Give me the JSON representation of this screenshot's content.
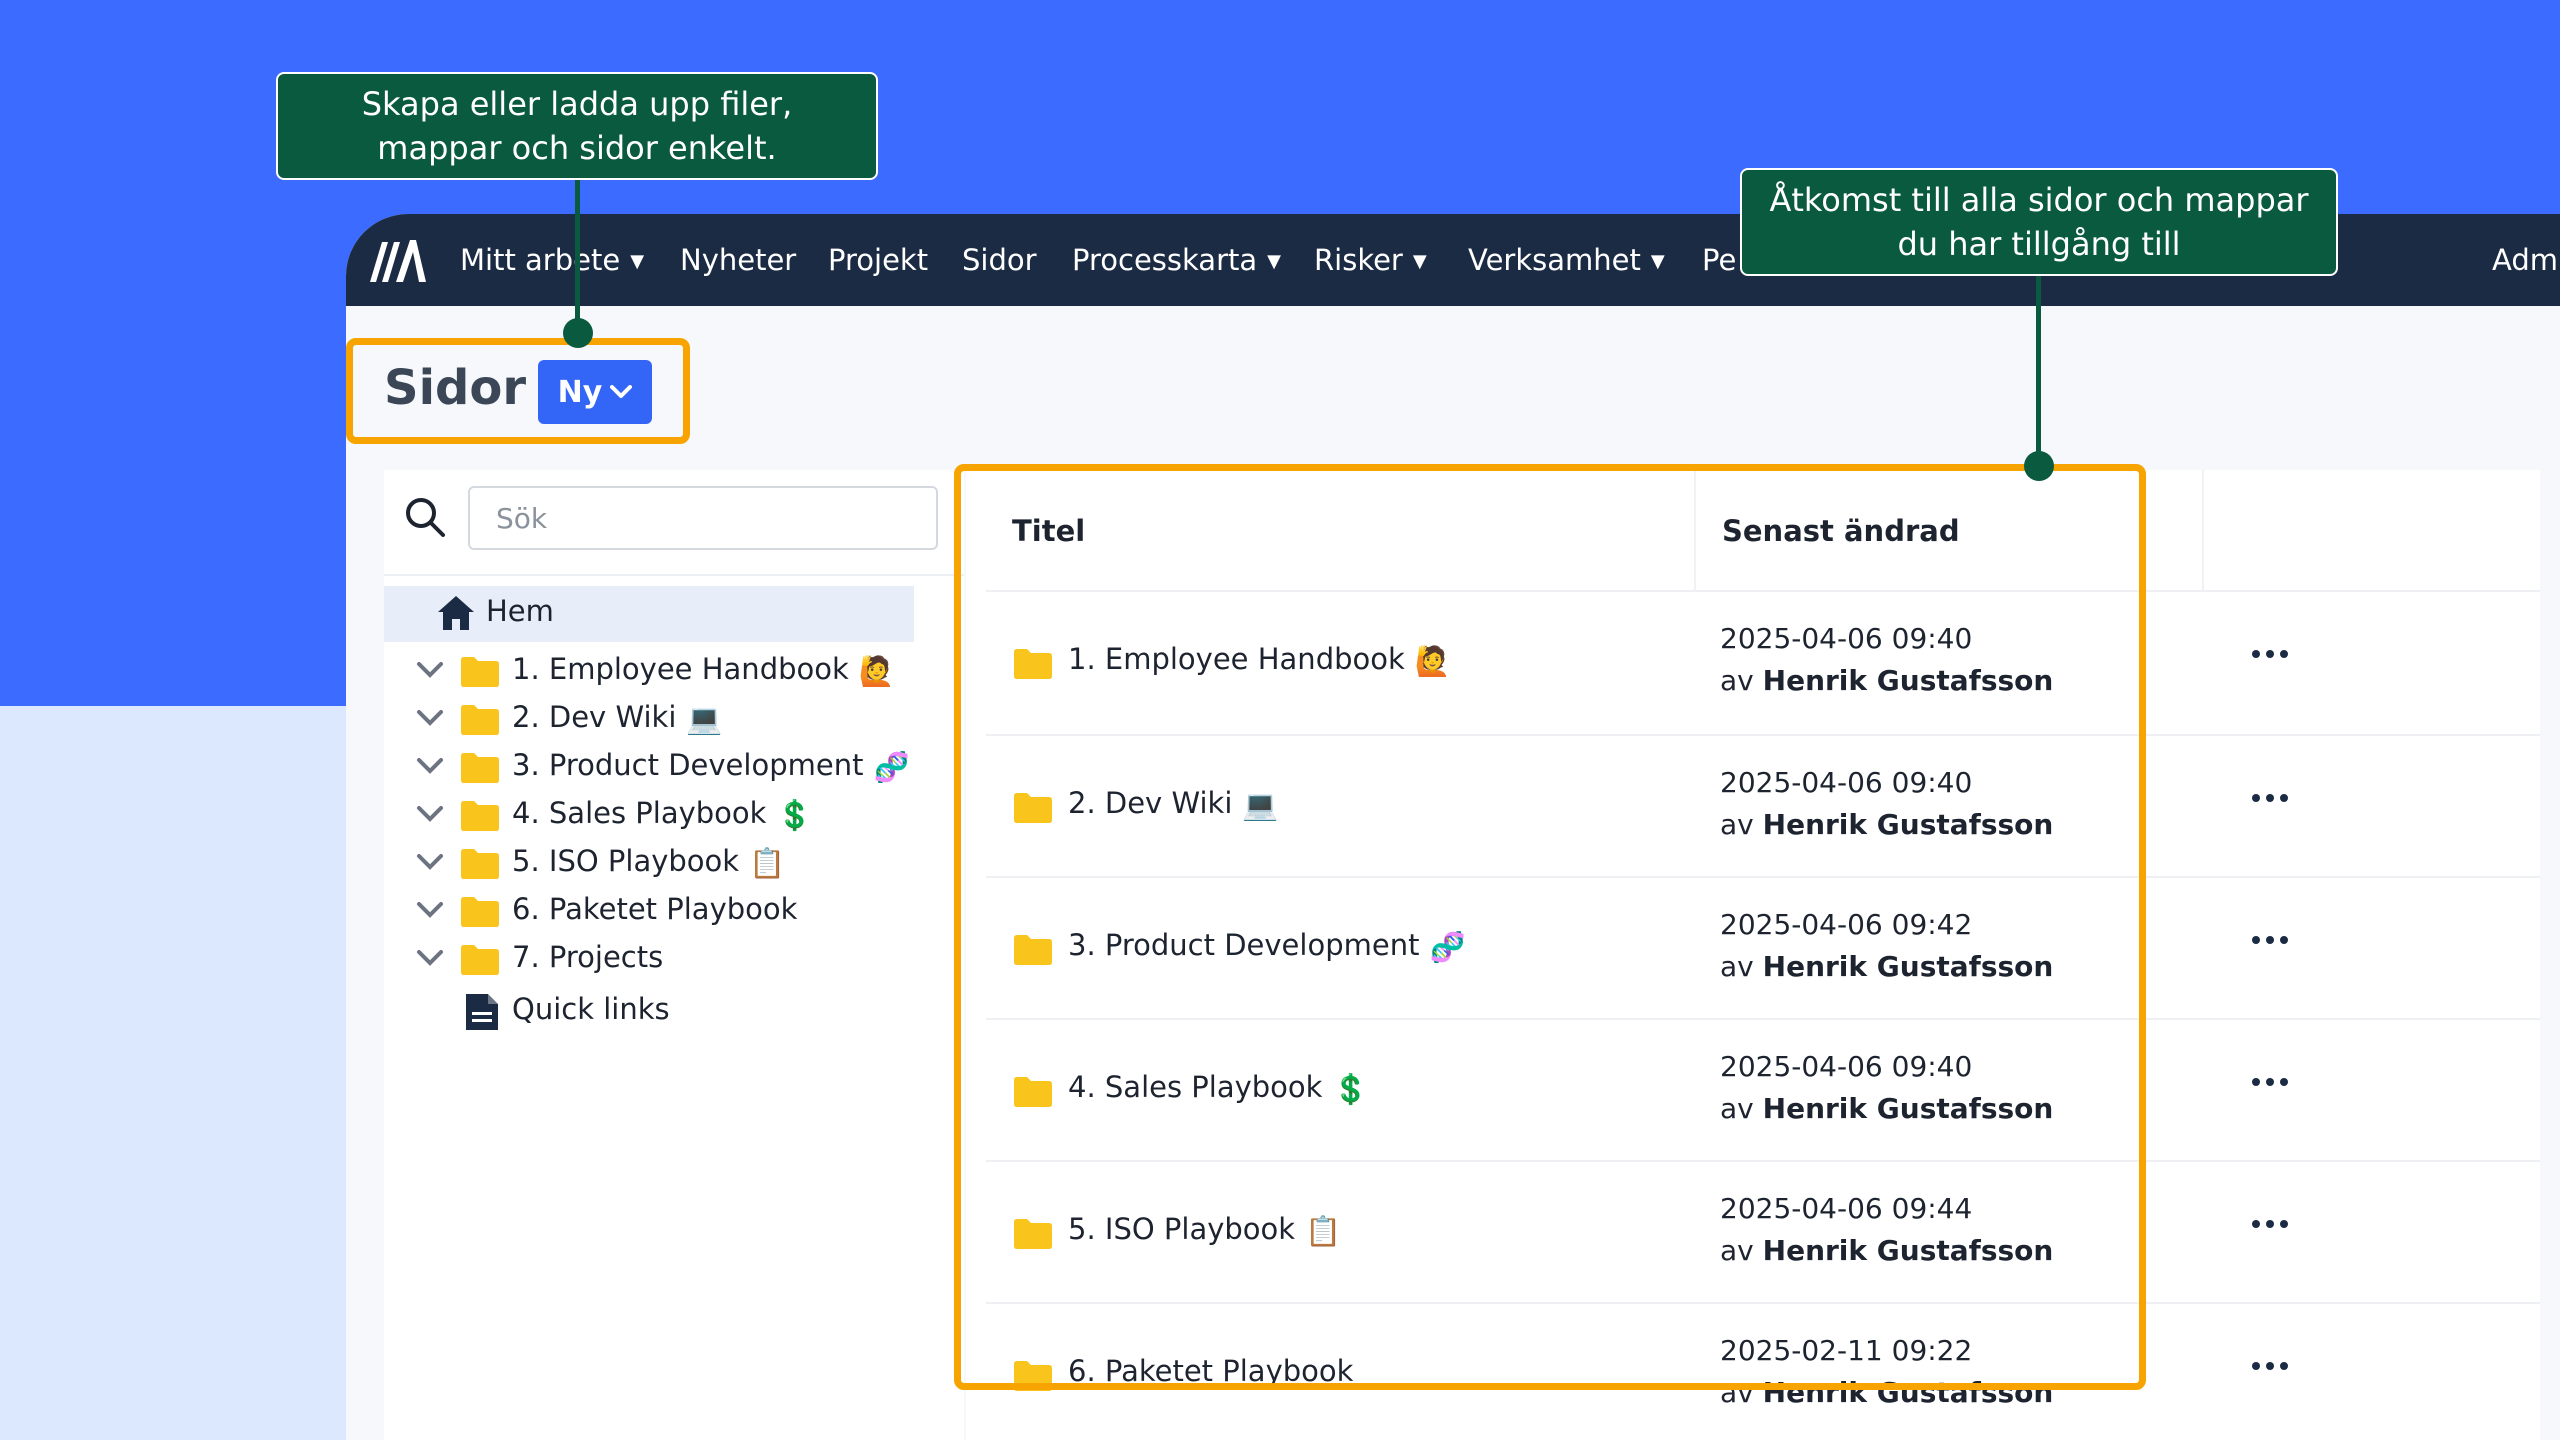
{
  "nav": {
    "items": [
      "Mitt arbete",
      "Nyheter",
      "Projekt",
      "Sidor",
      "Processkarta",
      "Risker",
      "Verksamhet",
      "Pe",
      "Admi"
    ]
  },
  "page": {
    "title": "Sidor",
    "new_button": "Ny"
  },
  "search": {
    "placeholder": "Sök"
  },
  "tree": {
    "home": "Hem",
    "items": [
      {
        "label": "1. Employee Handbook",
        "emoji": "🙋"
      },
      {
        "label": "2. Dev Wiki",
        "emoji": "💻"
      },
      {
        "label": "3. Product Development",
        "emoji": "🧬"
      },
      {
        "label": "4. Sales Playbook",
        "emoji": "💲"
      },
      {
        "label": "5. ISO Playbook",
        "emoji": "📋"
      },
      {
        "label": "6. Paketet Playbook",
        "emoji": ""
      },
      {
        "label": "7. Projects",
        "emoji": ""
      }
    ],
    "quick_links": "Quick links"
  },
  "table": {
    "col_title": "Titel",
    "col_modified": "Senast ändrad",
    "rows": [
      {
        "title": "1. Employee Handbook",
        "emoji": "🙋",
        "date": "2025-04-06 09:40",
        "by_prefix": "av",
        "author": "Henrik Gustafsson"
      },
      {
        "title": "2. Dev Wiki",
        "emoji": "💻",
        "date": "2025-04-06 09:40",
        "by_prefix": "av",
        "author": "Henrik Gustafsson"
      },
      {
        "title": "3. Product Development",
        "emoji": "🧬",
        "date": "2025-04-06 09:42",
        "by_prefix": "av",
        "author": "Henrik Gustafsson"
      },
      {
        "title": "4. Sales Playbook",
        "emoji": "💲",
        "date": "2025-04-06 09:40",
        "by_prefix": "av",
        "author": "Henrik Gustafsson"
      },
      {
        "title": "5. ISO Playbook",
        "emoji": "📋",
        "date": "2025-04-06 09:44",
        "by_prefix": "av",
        "author": "Henrik Gustafsson"
      },
      {
        "title": "6. Paketet Playbook",
        "emoji": "",
        "date": "2025-02-11 09:22",
        "by_prefix": "av",
        "author": "Henrik Gustafsson"
      }
    ]
  },
  "callouts": {
    "create": "Skapa eller ladda upp filer, mappar och sidor enkelt.",
    "access": "Åtkomst till alla sidor och mappar du har tillgång till"
  },
  "colors": {
    "nav_bg": "#1c2b44",
    "accent_blue": "#3366f6",
    "highlight_orange": "#f7a400",
    "callout_green": "#0a5a3f",
    "folder_yellow": "#f9c51c"
  }
}
